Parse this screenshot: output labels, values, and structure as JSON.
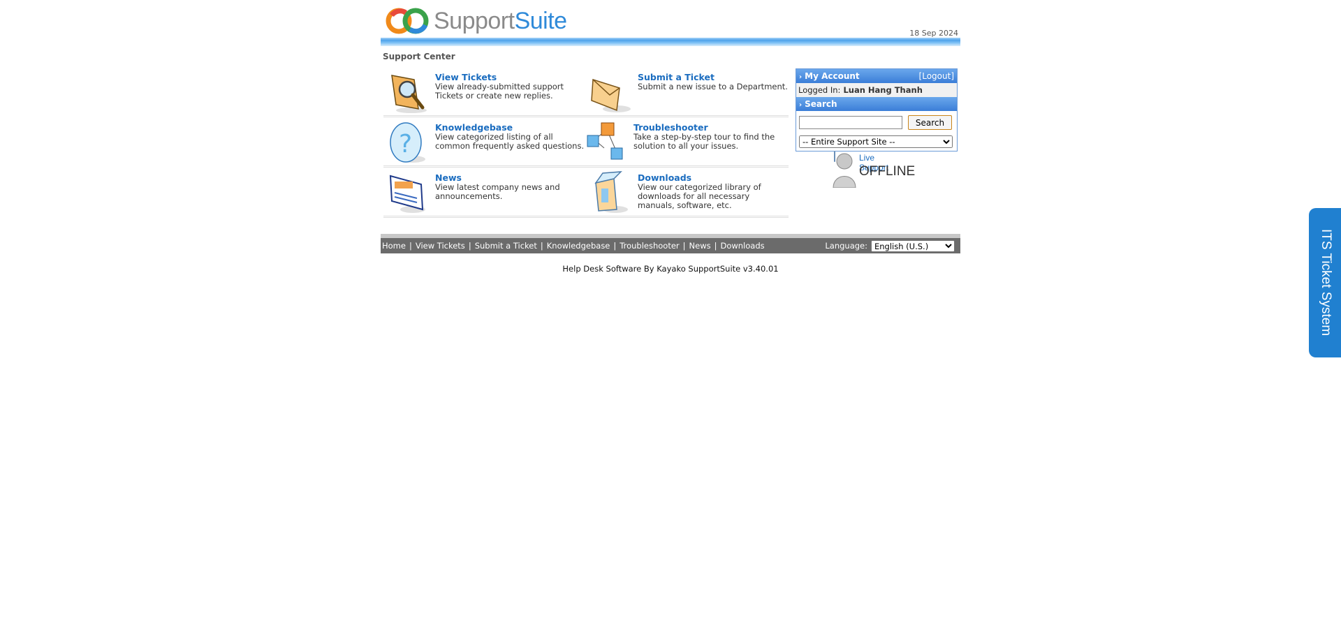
{
  "header": {
    "logo_word_1": "Support",
    "logo_word_2": "Suite",
    "date": "18 Sep 2024"
  },
  "section_title": "Support Center",
  "modules": [
    {
      "title": "View Tickets",
      "desc": "View already-submitted support Tickets or create new replies.",
      "icon": "magnifier-folder-icon"
    },
    {
      "title": "Submit a Ticket",
      "desc": "Submit a new issue to a Department.",
      "icon": "envelope-icon"
    },
    {
      "title": "Knowledgebase",
      "desc": "View categorized listing of all common frequently asked questions.",
      "icon": "question-mark-icon"
    },
    {
      "title": "Troubleshooter",
      "desc": "Take a step-by-step tour to find the solution to all your issues.",
      "icon": "cubes-icon"
    },
    {
      "title": "News",
      "desc": "View latest company news and announcements.",
      "icon": "newspaper-icon"
    },
    {
      "title": "Downloads",
      "desc": "View our categorized library of downloads for all necessary manuals, software, etc.",
      "icon": "box-icon"
    }
  ],
  "account": {
    "title": "My Account",
    "logout": "[Logout]",
    "logged_in_label": "Logged In:",
    "user": "Luan Hang Thanh"
  },
  "search": {
    "title": "Search",
    "button": "Search",
    "value": "",
    "scope": "-- Entire Support Site --"
  },
  "live_support": {
    "line1": "Live Support",
    "line2": "OFFLINE"
  },
  "footer_nav": {
    "links": [
      "Home",
      "View Tickets",
      "Submit a Ticket",
      "Knowledgebase",
      "Troubleshooter",
      "News",
      "Downloads"
    ],
    "language_label": "Language:",
    "language_value": "English (U.S.)"
  },
  "credit": "Help Desk Software By Kayako SupportSuite v3.40.01",
  "side_tab": "ITS Ticket System",
  "colors": {
    "accent": "#1a6cbf",
    "header_bar": "#4fa2ea",
    "nav_bg": "#6b6b6b",
    "side_tab": "#2080d0"
  }
}
